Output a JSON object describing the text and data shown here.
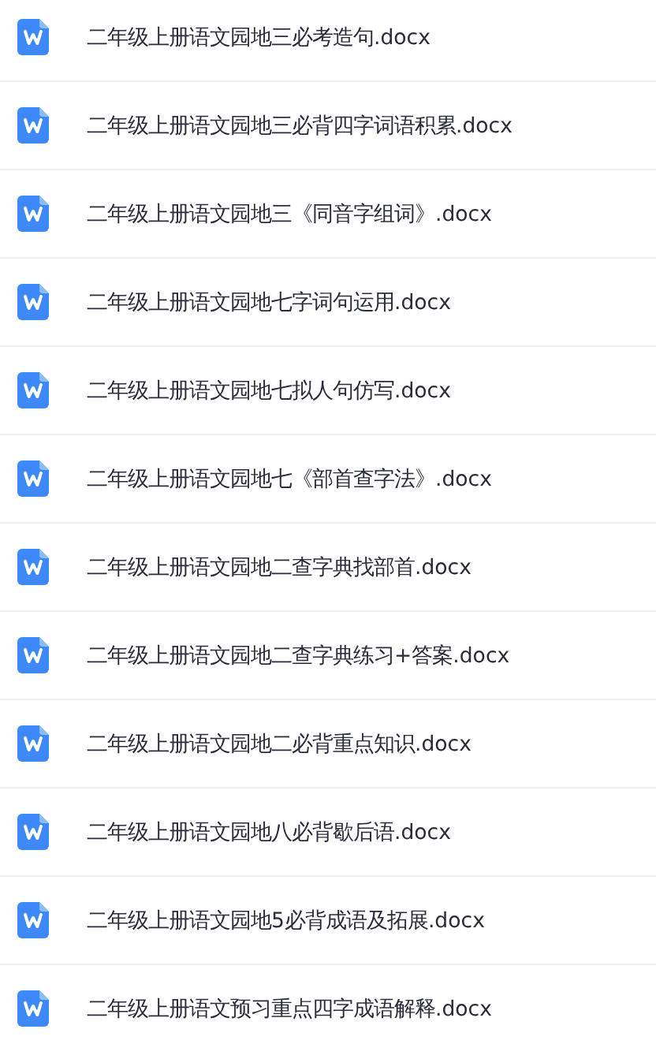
{
  "files": [
    {
      "name": "二年级上册语文园地三必考造句.docx"
    },
    {
      "name": "二年级上册语文园地三必背四字词语积累.docx"
    },
    {
      "name": "二年级上册语文园地三《同音字组词》.docx"
    },
    {
      "name": "二年级上册语文园地七字词句运用.docx"
    },
    {
      "name": "二年级上册语文园地七拟人句仿写.docx"
    },
    {
      "name": "二年级上册语文园地七《部首查字法》.docx"
    },
    {
      "name": "二年级上册语文园地二查字典找部首.docx"
    },
    {
      "name": "二年级上册语文园地二查字典练习+答案.docx"
    },
    {
      "name": "二年级上册语文园地二必背重点知识.docx"
    },
    {
      "name": "二年级上册语文园地八必背歇后语.docx"
    },
    {
      "name": "二年级上册语文园地5必背成语及拓展.docx"
    },
    {
      "name": "二年级上册语文预习重点四字成语解释.docx"
    }
  ]
}
